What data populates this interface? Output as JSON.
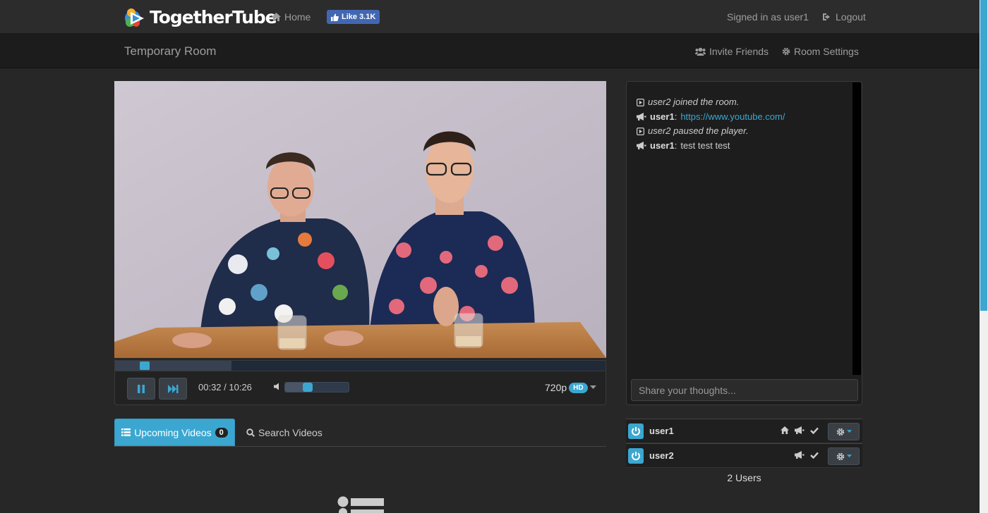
{
  "app": {
    "name": "TogetherTube",
    "nav_home": "Home",
    "fb_like": "Like 3.1K",
    "signed_in": "Signed in as user1",
    "logout": "Logout"
  },
  "room": {
    "title": "Temporary Room",
    "invite": "Invite Friends",
    "settings": "Room Settings"
  },
  "player": {
    "time": "00:32 / 10:26",
    "quality": "720p",
    "quality_badge": "HD",
    "progress_fraction": 0.051,
    "buffered_fraction": 0.237,
    "volume_fraction": 0.36
  },
  "tabs": {
    "upcoming_label": "Upcoming Videos",
    "upcoming_count": "0",
    "search_label": "Search Videos"
  },
  "chat": {
    "messages": [
      {
        "type": "event",
        "text": "user2 joined the room."
      },
      {
        "type": "chat",
        "user": "user1",
        "sep": ":",
        "text": "https://www.youtube.com/"
      },
      {
        "type": "event",
        "text": "user2 paused the player."
      },
      {
        "type": "chat",
        "user": "user1",
        "sep": ":",
        "text": "test test test"
      }
    ],
    "input_placeholder": "Share your thoughts..."
  },
  "users": {
    "list": [
      {
        "name": "user1"
      },
      {
        "name": "user2"
      }
    ],
    "count_label": "2 Users"
  },
  "colors": {
    "accent": "#3ba7d1",
    "background": "#272727",
    "navbar": "#2c2c2c",
    "facebook": "#4267b2"
  }
}
